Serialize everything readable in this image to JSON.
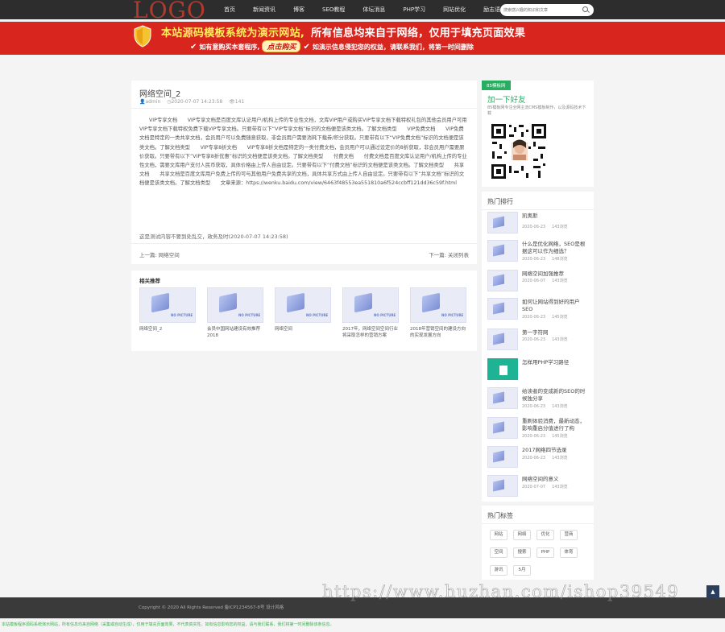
{
  "header": {
    "logo": "LOGO",
    "nav": [
      "首页",
      "新闻资讯",
      "博客",
      "SEO教程",
      "体坛消息",
      "PHP学习",
      "网站优化",
      "励志语录"
    ],
    "search_placeholder": "搜索感兴趣的知识和文章"
  },
  "banner": {
    "line1_part1": "本站源码模板系统为演示网站,",
    "line1_part2": "所有信息均来自于网络，仅用于填充页面效果",
    "line2_left": "如有意购买本套程序,",
    "buy_button": "点击购买",
    "line2_right": "如演示信息侵犯您的权益，请联系我们，将第一时间删除"
  },
  "article": {
    "title": "网络空间_2",
    "author": "admin",
    "date": "2020-07-07 14:23:58",
    "views": "141",
    "body": "VIP专享文档　　VIP专享文档是百度文库认证用户/机构上传的专业性文档，文库VIP用户或购买VIP专享文档下载特权礼包的其他会员用户可用VIP专享文档下载特权免费下载VIP专享文档。只要带有以下“VIP专享文档”标识的文档便是该类文档。了解文档类型　　VIP免费文档　　VIP免费文档是特定的一类共享文档，会员用户可以免费随意获取，非会员用户需要消耗下载券/积分获取。只要带有以下“VIP免费文档”标识的文档便是该类文档。了解文档类型　　VIP专享8折文档　　VIP专享8折文档是特定的一类付费文档，会员用户可以通过设定价的8折获取，非会员用户需要原价获取。只要带有以下“VIP专享8折优惠”标识的文档便是该类文档。了解文档类型　　付费文档　　付费文档是百度文库认证用户/机构上传的专业性文档，需要文库用户支付人民币获取，具体价格由上传人自由设定。只要带有以下“付费文档”标识的文档便是该类文档。了解文档类型　　共享文档　　共享文档是百度文库用户免费上传的可与其他用户免费共享的文档，具体共享方式由上传人自由设定。只要带有以下“共享文档”标识的文档便是该类文档。了解文档类型　　文章来源：https://wenku.baidu.com/view/6463f48553ea551810a6f524ccbff121dd36c59f.html",
    "source_note": "这是测试内容不要到处乱交，政务及时(2020-07-07 14:23:58)",
    "prev_label": "上一篇:",
    "prev_link": "网络空间",
    "next_label": "下一篇:",
    "next_link": "关闭列表"
  },
  "related": {
    "title": "相关推荐",
    "no_picture": "NO PICTURE",
    "items": [
      "网络空间_2",
      "会员中国网站建设有效推荐2018",
      "网络空间",
      "2017年，网络空间空间行业将采取怎样的营销方案",
      "2018年营销空间的建设方向的实现发展方向"
    ]
  },
  "sidebar": {
    "badge": "85模板网",
    "add_friend": "加一下好友",
    "friend_desc": "85模板网专注全网主流CMS模板制作，以及源码技术下载",
    "hot_title": "热门排行",
    "hot_items": [
      {
        "name": "凯奥斯",
        "date": "2020-06-23",
        "views": "143浏览"
      },
      {
        "name": "什么是优化网络，SEO是根据这可以作为细选？",
        "date": "2020-06-23",
        "views": "148浏览"
      },
      {
        "name": "网络空间加强推荐",
        "date": "2020-06-07",
        "views": "143浏览"
      },
      {
        "name": "如何让网站得到好的用户SEO",
        "date": "2020-06-23",
        "views": "145浏览"
      },
      {
        "name": "第一字符网",
        "date": "2020-06-23",
        "views": "143浏览"
      },
      {
        "name": "怎样用PHP学习路径",
        "date": "",
        "views": ""
      },
      {
        "name": "给读者的变成新的SEO的时候独分享",
        "date": "2020-06-23",
        "views": "143浏览"
      },
      {
        "name": "重刷体验消费，最新动态，影响重启分值进行了构",
        "date": "2020-06-23",
        "views": "145浏览"
      },
      {
        "name": "2017网络四节选录",
        "date": "2020-06-23",
        "views": "143浏览"
      },
      {
        "name": "网络空间的意义",
        "date": "2020-07-07",
        "views": "143浏览"
      }
    ],
    "tags_title": "热门标签",
    "tags": [
      "网站",
      "网络",
      "优化",
      "营商",
      "空间",
      "搜索",
      "PHP",
      "体育",
      "游讯",
      "5月"
    ]
  },
  "footer": {
    "copyright": "Copyright © 2020 All Rights Reserved 备ICP1234567-8号 设计风格",
    "watermark": "https://www.huzhan.com/ishop39549",
    "to_top": "▲",
    "disclaimer": "本站模板程序源码系统演示网站，所有信息均来自网络（采集或自动生成），仅用于填充页面效果，不代表真实性。如有信息影响您的权益，请与我们联系，我们将第一时间删除该条信息。"
  },
  "colors": {
    "accent_green": "#27ae60",
    "banner_red": "#d8261f",
    "logo_red": "#b03a2e"
  }
}
